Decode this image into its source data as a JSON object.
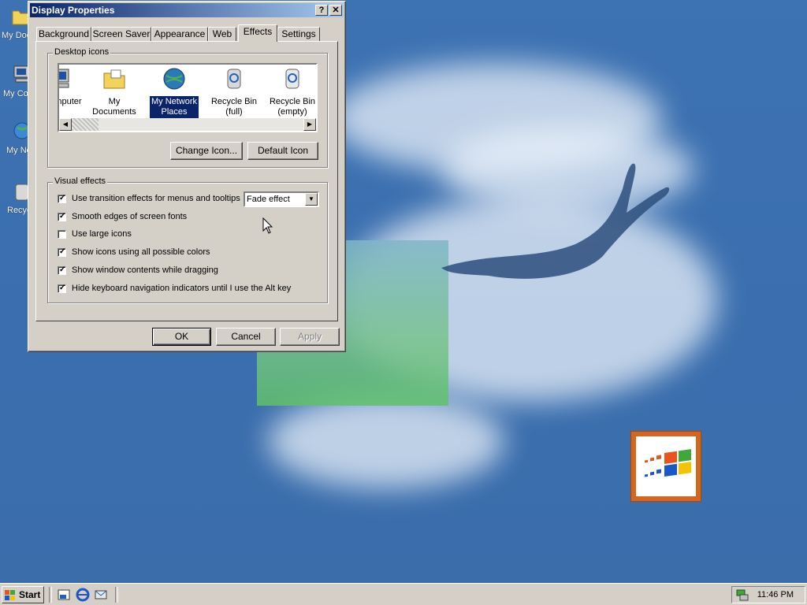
{
  "desktop": {
    "icons": [
      {
        "label": "My Documents",
        "icon": "folder-documents-icon"
      },
      {
        "label": "My Computer",
        "icon": "computer-icon"
      },
      {
        "label": "My Network Places",
        "icon": "network-places-icon"
      },
      {
        "label": "Recycle Bin",
        "icon": "recycle-bin-icon"
      }
    ]
  },
  "window": {
    "title": "Display Properties",
    "help_btn": "?",
    "close_btn": "✕",
    "tabs": [
      "Background",
      "Screen Saver",
      "Appearance",
      "Web",
      "Effects",
      "Settings"
    ],
    "active_tab": "Effects",
    "desktop_icons": {
      "label": "Desktop icons",
      "items": [
        {
          "label": "My Computer",
          "shown": "nputer",
          "icon": "computer-icon"
        },
        {
          "label": "My Documents",
          "icon": "folder-documents-icon"
        },
        {
          "label": "My Network Places",
          "line1": "My Network",
          "line2": "Places",
          "icon": "network-places-icon",
          "selected": true
        },
        {
          "label": "Recycle Bin (full)",
          "line1": "Recycle Bin",
          "line2": "(full)",
          "icon": "recycle-bin-full-icon"
        },
        {
          "label": "Recycle Bin (empty)",
          "line1": "Recycle Bin",
          "line2": "(empty)",
          "icon": "recycle-bin-empty-icon"
        }
      ],
      "change_icon_btn": "Change Icon...",
      "default_icon_btn": "Default Icon"
    },
    "visual_effects": {
      "label": "Visual effects",
      "options": [
        {
          "label": "Use transition effects for menus and tooltips",
          "checked": true
        },
        {
          "label": "Smooth edges of screen fonts",
          "checked": true
        },
        {
          "label": "Use large icons",
          "checked": false
        },
        {
          "label": "Show icons using all possible colors",
          "checked": true
        },
        {
          "label": "Show window contents while dragging",
          "checked": true
        },
        {
          "label": "Hide keyboard navigation indicators until I use the Alt key",
          "checked": true
        }
      ],
      "transition_select": "Fade effect"
    },
    "buttons": {
      "ok": "OK",
      "cancel": "Cancel",
      "apply": "Apply"
    }
  },
  "taskbar": {
    "start_label": "Start",
    "clock": "11:46 PM"
  },
  "colors": {
    "title_start": "#0a246a",
    "title_end": "#a6caf0",
    "face": "#d4d0c8",
    "desktop": "#3b6fae"
  }
}
